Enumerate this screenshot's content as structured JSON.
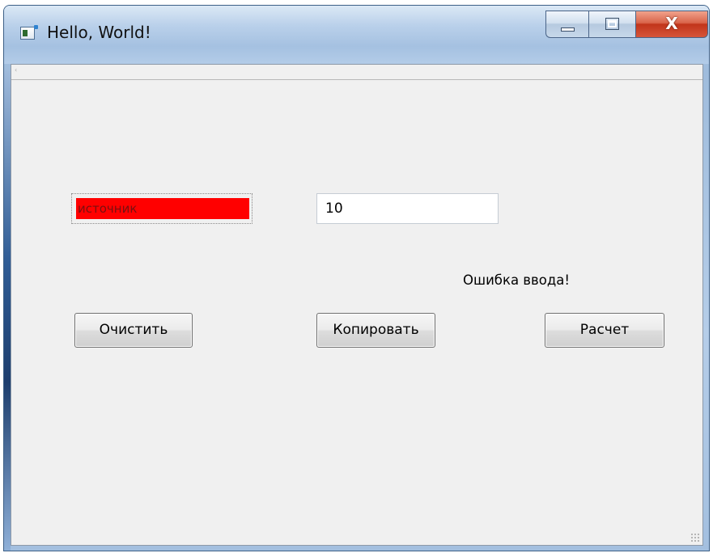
{
  "window": {
    "title": "Hello, World!",
    "controls": {
      "minimize": "minimize-icon",
      "maximize": "maximize-icon",
      "close": "close-icon",
      "close_glyph": "X"
    },
    "close_color": "#c1341a"
  },
  "form": {
    "source_field": {
      "value": "источник",
      "background": "#ff0000"
    },
    "number_field": {
      "value": "10"
    },
    "error_label": "Ошибка ввода!",
    "buttons": {
      "clear": "Очистить",
      "copy": "Копировать",
      "calc": "Расчет"
    }
  },
  "colors": {
    "client_bg": "#f0f0f0",
    "error_field_bg": "#ff0000"
  }
}
